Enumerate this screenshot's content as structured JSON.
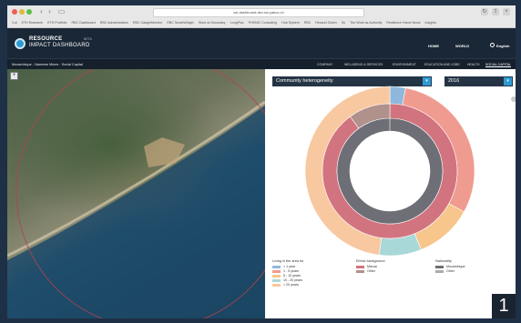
{
  "browser": {
    "url": "ssi-dashboard-dev.ssi.yakus.ch",
    "bookmarks": [
      "Cut",
      "ETH Research",
      "ETH Portfolio",
      "RBC Dashboard",
      "RBC Administration",
      "RBC GadgetMonitor",
      "RBC SmartWidget",
      "Store on Boundary",
      "LongPlus",
      "PHENIC Consulting",
      "Hub System",
      "RBC",
      "Ressort Zürich",
      "So",
      "The Work as Authority",
      "Resilience Home News",
      "Insights"
    ]
  },
  "header": {
    "logo_line1": "RESOURCE",
    "logo_line2": "IMPACT DASHBOARD",
    "beta": "BETA",
    "nav": {
      "home": "HOME",
      "world": "WORLD",
      "language": "English"
    }
  },
  "subnav": {
    "breadcrumb": "Mozambique - Namewe Mines · Social Capital",
    "tabs": [
      "COMPANY",
      "WELLBEING & SERVICES",
      "ENVIRONMENT",
      "EDUCATION AND JOBS",
      "HEALTH",
      "SOCIAL CAPITAL"
    ],
    "active_tab": "SOCIAL CAPITAL"
  },
  "map": {
    "zoom_label": "+"
  },
  "panel": {
    "indicator_select": "Community heterogeneity",
    "year_select": "2016"
  },
  "chart_data": {
    "type": "pie",
    "rings": [
      {
        "name": "Living in the area for",
        "slices": [
          {
            "label": "< 1 year",
            "value": 3,
            "color": "#8fb8dc"
          },
          {
            "label": "1 - 5 years",
            "value": 30,
            "color": "#f09b8f"
          },
          {
            "label": "5 - 10 years",
            "value": 11,
            "color": "#f6c68c"
          },
          {
            "label": "10 - 20 years",
            "value": 8,
            "color": "#a9d8d8"
          },
          {
            "label": "> 20 years",
            "value": 48,
            "color": "#f8c8a0"
          }
        ]
      },
      {
        "name": "Ethnic background",
        "slices": [
          {
            "label": "Macua",
            "value": 90,
            "color": "#d2747f"
          },
          {
            "label": "Other",
            "value": 10,
            "color": "#b0918c"
          }
        ]
      },
      {
        "name": "Nationality",
        "slices": [
          {
            "label": "Mozambique",
            "value": 100,
            "color": "#6e6e76"
          },
          {
            "label": "Other",
            "value": 0,
            "color": "#b0a9a9"
          }
        ]
      }
    ]
  },
  "legends": [
    {
      "title": "Living in the area for",
      "items": [
        {
          "label": "< 1 year",
          "color": "#8fb8dc"
        },
        {
          "label": "1 - 5 years",
          "color": "#f09b8f"
        },
        {
          "label": "5 - 10 years",
          "color": "#f6c68c"
        },
        {
          "label": "10 - 20 years",
          "color": "#a9d8d8"
        },
        {
          "label": "> 20 years",
          "color": "#f8c8a0"
        }
      ]
    },
    {
      "title": "Ethnic background",
      "items": [
        {
          "label": "Macua",
          "color": "#d2747f"
        },
        {
          "label": "Other",
          "color": "#b0918c"
        }
      ]
    },
    {
      "title": "Nationality",
      "items": [
        {
          "label": "Mozambique",
          "color": "#6e6e76"
        },
        {
          "label": "Other",
          "color": "#b0a9a9"
        }
      ]
    }
  ],
  "badge": "1"
}
